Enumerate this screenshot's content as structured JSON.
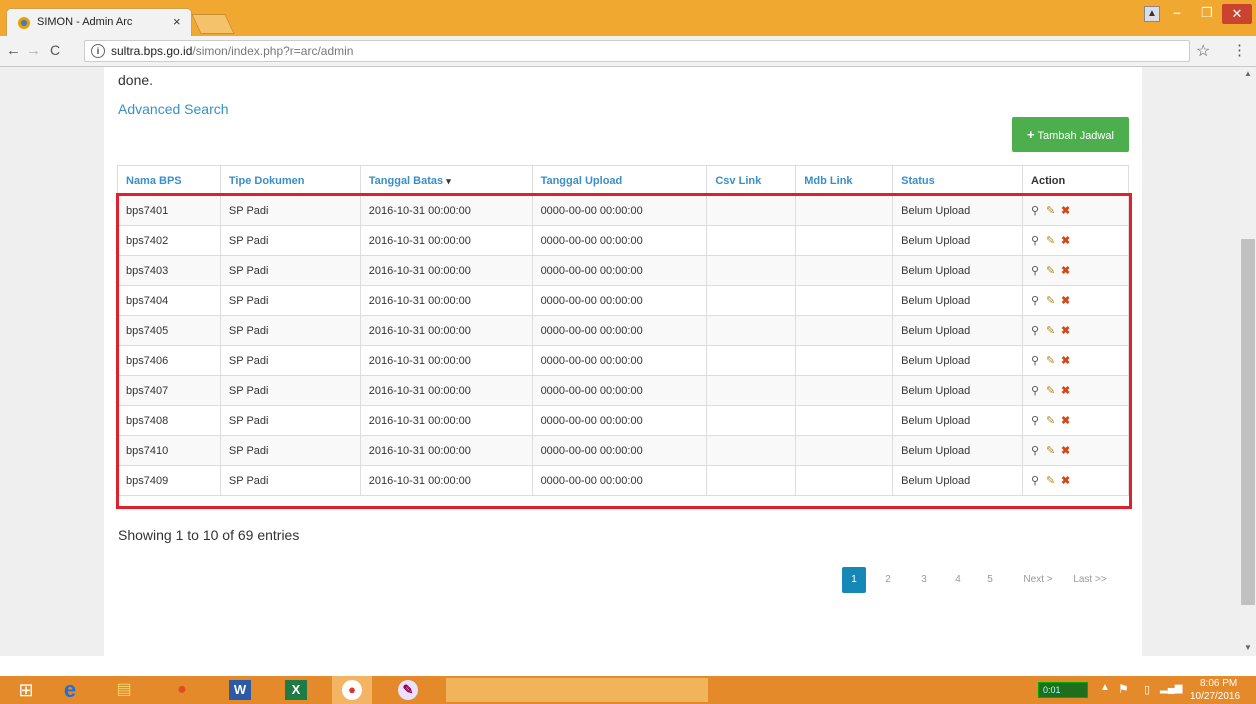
{
  "browser": {
    "tab_title": "SIMON - Admin Arc",
    "tab_close": "×",
    "url_domain": "sultra.bps.go.id",
    "url_path": "/simon/index.php?r=arc/admin"
  },
  "page": {
    "intro_tail": "done.",
    "advanced_search": "Advanced Search",
    "add_button_icon": "+",
    "add_button_label": "Tambah Jadwal",
    "summary": "Showing 1 to 10 of 69 entries"
  },
  "table": {
    "headers": [
      "Nama BPS",
      "Tipe Dokumen",
      "Tanggal Batas",
      "Tanggal Upload",
      "Csv Link",
      "Mdb Link",
      "Status",
      "Action"
    ],
    "sort_indicator": "▾",
    "rows": [
      {
        "nama": "bps7401",
        "tipe": "SP Padi",
        "batas": "2016-10-31 00:00:00",
        "upload": "0000-00-00 00:00:00",
        "csv": "",
        "mdb": "",
        "status": "Belum Upload"
      },
      {
        "nama": "bps7402",
        "tipe": "SP Padi",
        "batas": "2016-10-31 00:00:00",
        "upload": "0000-00-00 00:00:00",
        "csv": "",
        "mdb": "",
        "status": "Belum Upload"
      },
      {
        "nama": "bps7403",
        "tipe": "SP Padi",
        "batas": "2016-10-31 00:00:00",
        "upload": "0000-00-00 00:00:00",
        "csv": "",
        "mdb": "",
        "status": "Belum Upload"
      },
      {
        "nama": "bps7404",
        "tipe": "SP Padi",
        "batas": "2016-10-31 00:00:00",
        "upload": "0000-00-00 00:00:00",
        "csv": "",
        "mdb": "",
        "status": "Belum Upload"
      },
      {
        "nama": "bps7405",
        "tipe": "SP Padi",
        "batas": "2016-10-31 00:00:00",
        "upload": "0000-00-00 00:00:00",
        "csv": "",
        "mdb": "",
        "status": "Belum Upload"
      },
      {
        "nama": "bps7406",
        "tipe": "SP Padi",
        "batas": "2016-10-31 00:00:00",
        "upload": "0000-00-00 00:00:00",
        "csv": "",
        "mdb": "",
        "status": "Belum Upload"
      },
      {
        "nama": "bps7407",
        "tipe": "SP Padi",
        "batas": "2016-10-31 00:00:00",
        "upload": "0000-00-00 00:00:00",
        "csv": "",
        "mdb": "",
        "status": "Belum Upload"
      },
      {
        "nama": "bps7408",
        "tipe": "SP Padi",
        "batas": "2016-10-31 00:00:00",
        "upload": "0000-00-00 00:00:00",
        "csv": "",
        "mdb": "",
        "status": "Belum Upload"
      },
      {
        "nama": "bps7410",
        "tipe": "SP Padi",
        "batas": "2016-10-31 00:00:00",
        "upload": "0000-00-00 00:00:00",
        "csv": "",
        "mdb": "",
        "status": "Belum Upload"
      },
      {
        "nama": "bps7409",
        "tipe": "SP Padi",
        "batas": "2016-10-31 00:00:00",
        "upload": "0000-00-00 00:00:00",
        "csv": "",
        "mdb": "",
        "status": "Belum Upload"
      }
    ],
    "action_icons": [
      "view-icon",
      "edit-icon",
      "delete-icon"
    ]
  },
  "pagination": {
    "pages": [
      "1",
      "2",
      "3",
      "4",
      "5"
    ],
    "active_page": "1",
    "next": "Next >",
    "last": "Last >>"
  },
  "taskbar": {
    "meter": "0:01",
    "time": "8:06 PM",
    "date": "10/27/2016"
  },
  "colors": {
    "link": "#3a8fc8",
    "add_button": "#4cae4c",
    "highlight": "#e0202a",
    "active_page": "#1688b8",
    "titlebar": "#f0a830",
    "taskbar": "#e58a2a"
  }
}
